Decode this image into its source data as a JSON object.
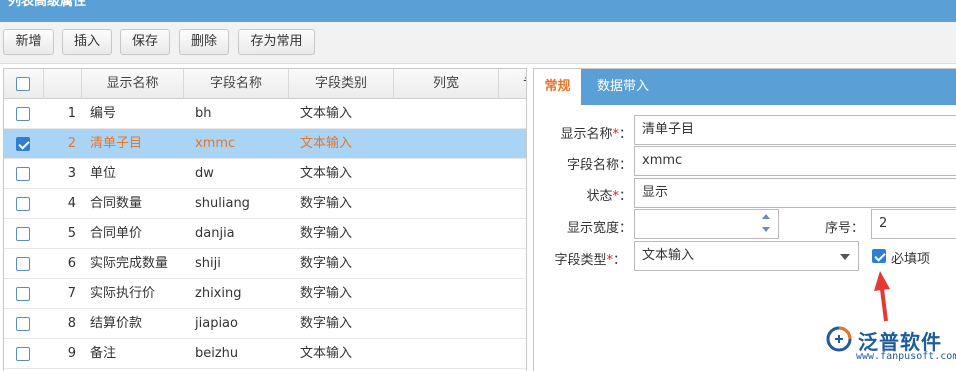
{
  "window": {
    "title": "列表高级属性"
  },
  "toolbar": {
    "add": "新增",
    "insert": "插入",
    "save": "保存",
    "delete": "删除",
    "save_common": "存为常用"
  },
  "grid": {
    "headers": {
      "display_name": "显示名称",
      "field_name": "字段名称",
      "field_type": "字段类别",
      "col_width": "列宽",
      "extra": "专"
    },
    "rows": [
      {
        "no": "1",
        "display": "编号",
        "field": "bh",
        "type": "文本输入",
        "checked": false
      },
      {
        "no": "2",
        "display": "清单子目",
        "field": "xmmc",
        "type": "文本输入",
        "checked": true
      },
      {
        "no": "3",
        "display": "单位",
        "field": "dw",
        "type": "文本输入",
        "checked": false
      },
      {
        "no": "4",
        "display": "合同数量",
        "field": "shuliang",
        "type": "数字输入",
        "checked": false
      },
      {
        "no": "5",
        "display": "合同单价",
        "field": "danjia",
        "type": "数字输入",
        "checked": false
      },
      {
        "no": "6",
        "display": "实际完成数量",
        "field": "shiji",
        "type": "数字输入",
        "checked": false
      },
      {
        "no": "7",
        "display": "实际执行价",
        "field": "zhixing",
        "type": "数字输入",
        "checked": false
      },
      {
        "no": "8",
        "display": "结算价款",
        "field": "jiapiao",
        "type": "数字输入",
        "checked": false
      },
      {
        "no": "9",
        "display": "备注",
        "field": "beizhu",
        "type": "文本输入",
        "checked": false
      }
    ]
  },
  "panel": {
    "tabs": {
      "general": "常规",
      "data_import": "数据带入"
    },
    "labels": {
      "display_name": "显示名称",
      "field_name": "字段名称：",
      "status": "状态",
      "display_width": "显示宽度：",
      "seq": "序号：",
      "field_type": "字段类型",
      "required": "必填项"
    },
    "values": {
      "display_name": "清单子目",
      "field_name": "xmmc",
      "status": "显示",
      "display_width": "",
      "seq": "2",
      "field_type": "文本输入",
      "required": true
    }
  },
  "watermark": {
    "brand": "泛普软件",
    "url": "www.fanpusoft.com"
  },
  "colors": {
    "header_blue": "#5a9fd6",
    "selected_row": "#a9d4f5",
    "selected_text": "#e8742a",
    "required_star": "#e02020",
    "arrow": "#e53935"
  }
}
